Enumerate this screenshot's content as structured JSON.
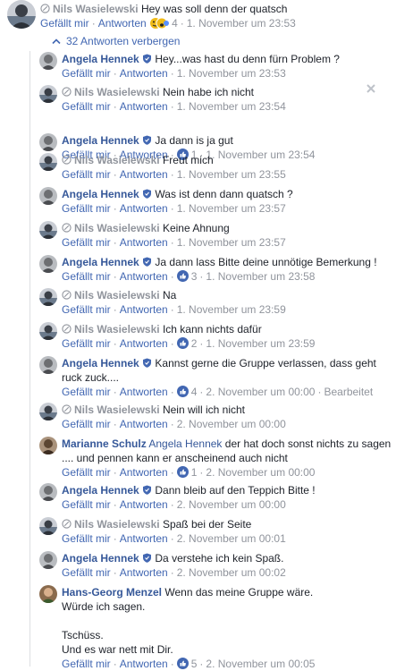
{
  "top_comment": {
    "author": "Nils Wasielewski",
    "text": "Hey was soll denn der quatsch",
    "like_label": "Gefällt mir",
    "reply_label": "Antworten",
    "reaction_count": "4",
    "time": "1. November um 23:53"
  },
  "hide_replies": "32 Antworten verbergen",
  "replies": [
    {
      "author": "Angela Hennek",
      "text": "Hey...was hast du denn fürn Problem ?",
      "time": "1. November um 23:53"
    },
    {
      "author": "Nils Wasielewski",
      "text": "Nein habe ich nicht",
      "time": "1. November um 23:54"
    },
    {
      "author": "Angela Hennek",
      "text": "Ja dann is ja gut",
      "likes": "1",
      "time": "1. November um 23:54"
    },
    {
      "author": "Nils Wasielewski",
      "text": "Freut mich",
      "time": "1. November um 23:55"
    },
    {
      "author": "Angela Hennek",
      "text": "Was ist denn dann quatsch ?",
      "time": "1. November um 23:57"
    },
    {
      "author": "Nils Wasielewski",
      "text": "Keine Ahnung",
      "time": "1. November um 23:57"
    },
    {
      "author": "Angela Hennek",
      "text": "Ja dann lass Bitte deine unnötige Bemerkung !",
      "likes": "3",
      "time": "1. November um 23:58"
    },
    {
      "author": "Nils Wasielewski",
      "text": "Na",
      "time": "1. November um 23:59"
    },
    {
      "author": "Nils Wasielewski",
      "text": "Ich kann nichts dafür",
      "likes": "2",
      "time": "1. November um 23:59"
    },
    {
      "author": "Angela Hennek",
      "text": "Kannst gerne die Gruppe verlassen, dass geht ruck zuck....",
      "likes": "4",
      "time": "2. November um 00:00",
      "edited": "Bearbeitet"
    },
    {
      "author": "Nils Wasielewski",
      "text": "Nein will ich nicht",
      "time": "2. November um 00:00"
    },
    {
      "author": "Marianne Schulz",
      "mention": "Angela Hennek",
      "text": "der hat doch sonst nichts zu sagen .... und pennen kann er anscheinend auch nicht",
      "likes": "1",
      "time": "2. November um 00:00"
    },
    {
      "author": "Angela Hennek",
      "text": "Dann bleib auf den Teppich Bitte !",
      "time": "2. November um 00:00"
    },
    {
      "author": "Nils Wasielewski",
      "text": "Spaß bei der Seite",
      "time": "2. November um 00:01"
    },
    {
      "author": "Angela Hennek",
      "text": "Da verstehe ich kein Spaß.",
      "time": "2. November um 00:02"
    },
    {
      "author": "Hans-Georg Menzel",
      "text_lines": [
        "Wenn das meine Gruppe wäre.",
        "Würde ich sagen.",
        "",
        "Tschüss.",
        "Und es war nett mit Dir."
      ],
      "likes": "5",
      "time": "2. November um 00:05"
    }
  ],
  "labels": {
    "like": "Gefällt mir",
    "reply": "Antworten"
  },
  "colors": {
    "link": "#365899",
    "action": "#4267b2",
    "meta": "#90949c",
    "like_icon": "#4267b2"
  }
}
